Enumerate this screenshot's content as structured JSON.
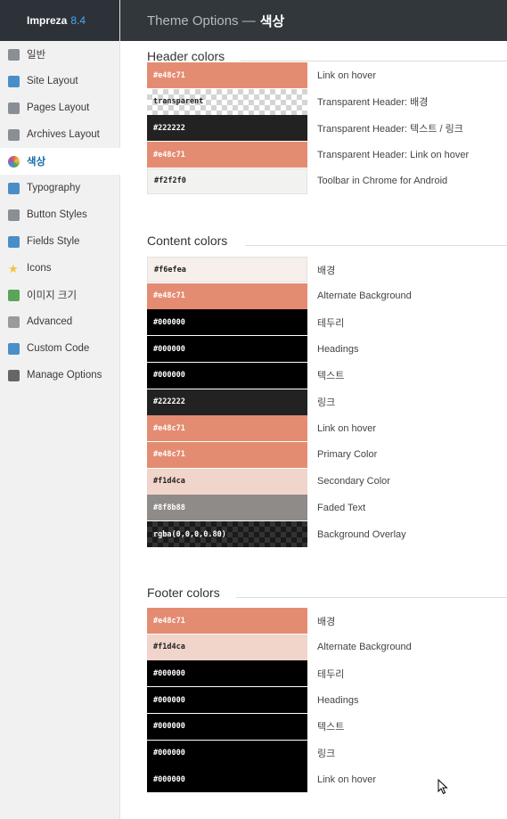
{
  "brand": {
    "name": "Impreza",
    "version": "8.4"
  },
  "topbar": {
    "prefix": "Theme Options —",
    "current": "색상"
  },
  "sidebar": {
    "items": [
      {
        "label": "일반",
        "icon": "general-icon",
        "color": "#8a8f96"
      },
      {
        "label": "Site Layout",
        "icon": "site-layout-icon",
        "color": "#4a8ec7"
      },
      {
        "label": "Pages Layout",
        "icon": "pages-layout-icon",
        "color": "#8a8f96"
      },
      {
        "label": "Archives Layout",
        "icon": "archives-layout-icon",
        "color": "#8a8f96"
      },
      {
        "label": "색상",
        "icon": "colors-icon",
        "color": "#e0614a",
        "active": true
      },
      {
        "label": "Typography",
        "icon": "typography-icon",
        "color": "#4a8ec7"
      },
      {
        "label": "Button Styles",
        "icon": "button-styles-icon",
        "color": "#8a8f96"
      },
      {
        "label": "Fields Style",
        "icon": "fields-style-icon",
        "color": "#4a8ec7"
      },
      {
        "label": "Icons",
        "icon": "star-icon",
        "color": "#f5c33b"
      },
      {
        "label": "이미지 크기",
        "icon": "image-sizes-icon",
        "color": "#5aa55a"
      },
      {
        "label": "Advanced",
        "icon": "gear-icon",
        "color": "#9a9a9a"
      },
      {
        "label": "Custom Code",
        "icon": "code-icon",
        "color": "#4a8ec7"
      },
      {
        "label": "Manage Options",
        "icon": "manage-options-icon",
        "color": "#666666"
      }
    ]
  },
  "header_section": {
    "title": "Header colors",
    "rows": [
      {
        "value": "#e48c71",
        "label": "Link on hover",
        "bg": "#e48c71",
        "fg": "#ffffff"
      },
      {
        "value": "transparent",
        "label": "Transparent Header: 배경",
        "bg": "transparent",
        "fg": "#222222"
      },
      {
        "value": "#222222",
        "label": "Transparent Header: 텍스트 / 링크",
        "bg": "#222222",
        "fg": "#ffffff"
      },
      {
        "value": "#e48c71",
        "label": "Transparent Header: Link on hover",
        "bg": "#e48c71",
        "fg": "#ffffff"
      },
      {
        "value": "#f2f2f0",
        "label": "Toolbar in Chrome for Android",
        "bg": "#f2f2f0",
        "fg": "#222222"
      }
    ]
  },
  "content_section": {
    "title": "Content colors",
    "rows": [
      {
        "value": "#f6efea",
        "label": "배경",
        "bg": "#f6efea",
        "fg": "#222222"
      },
      {
        "value": "#e48c71",
        "label": "Alternate Background",
        "bg": "#e48c71",
        "fg": "#ffffff"
      },
      {
        "value": "#000000",
        "label": "테두리",
        "bg": "#000000",
        "fg": "#ffffff"
      },
      {
        "value": "#000000",
        "label": "Headings",
        "bg": "#000000",
        "fg": "#ffffff"
      },
      {
        "value": "#000000",
        "label": "텍스트",
        "bg": "#000000",
        "fg": "#ffffff"
      },
      {
        "value": "#222222",
        "label": "링크",
        "bg": "#222222",
        "fg": "#ffffff"
      },
      {
        "value": "#e48c71",
        "label": "Link on hover",
        "bg": "#e48c71",
        "fg": "#ffffff"
      },
      {
        "value": "#e48c71",
        "label": "Primary Color",
        "bg": "#e48c71",
        "fg": "#ffffff"
      },
      {
        "value": "#f1d4ca",
        "label": "Secondary Color",
        "bg": "#f1d4ca",
        "fg": "#222222"
      },
      {
        "value": "#8f8b88",
        "label": "Faded Text",
        "bg": "#8f8b88",
        "fg": "#ffffff"
      },
      {
        "value": "rgba(0,0,0,0.80)",
        "label": "Background Overlay",
        "bg": "rgba-dark",
        "fg": "#ffffff"
      }
    ]
  },
  "footer_section": {
    "title": "Footer colors",
    "rows": [
      {
        "value": "#e48c71",
        "label": "배경",
        "bg": "#e48c71",
        "fg": "#ffffff"
      },
      {
        "value": "#f1d4ca",
        "label": "Alternate Background",
        "bg": "#f1d4ca",
        "fg": "#222222"
      },
      {
        "value": "#000000",
        "label": "테두리",
        "bg": "#000000",
        "fg": "#ffffff"
      },
      {
        "value": "#000000",
        "label": "Headings",
        "bg": "#000000",
        "fg": "#ffffff"
      },
      {
        "value": "#000000",
        "label": "텍스트",
        "bg": "#000000",
        "fg": "#ffffff"
      },
      {
        "value": "#000000",
        "label": "링크",
        "bg": "#000000",
        "fg": "#ffffff"
      },
      {
        "value": "#000000",
        "label": "Link on hover",
        "bg": "#000000",
        "fg": "#ffffff"
      }
    ]
  }
}
